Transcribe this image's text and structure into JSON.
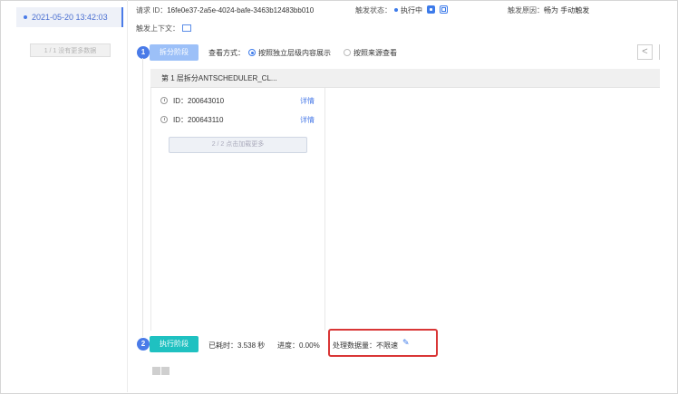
{
  "sidebar": {
    "time_item": "2021-05-20 13:42:03",
    "more_button": "1 / 1 没有更多数据"
  },
  "header": {
    "request_id_label": "请求 ID：",
    "request_id_value": "16fe0e37-2a5e-4024-bafe-3463b12483bb010",
    "trigger_status_label": "触发状态：",
    "trigger_status_value": "执行中",
    "trigger_reason_label": "触发原因：",
    "trigger_reason_value": "畅为 手动触发",
    "context_label": "触发上下文："
  },
  "step1": {
    "number": "1",
    "button": "拆分阶段",
    "view_mode_label": "查看方式：",
    "option1": "按照独立层级内容展示",
    "option2": "按照来源查看",
    "prev_icon": "<"
  },
  "split": {
    "header": "第 1 层拆分ANTSCHEDULER_CL...",
    "items": [
      {
        "id": "ID：200643010",
        "link": "详情"
      },
      {
        "id": "ID：200643110",
        "link": "详情"
      }
    ],
    "load_more": "2 / 2 点击加载更多"
  },
  "step2": {
    "number": "2",
    "button": "执行阶段",
    "elapsed": "已耗时：3.538 秒",
    "progress": "进度：0.00%",
    "data_amount": "处理数据量：不限速"
  },
  "colors": {
    "accent": "#4a7be8",
    "step2": "#1fc1c1",
    "highlight": "#d93636"
  }
}
